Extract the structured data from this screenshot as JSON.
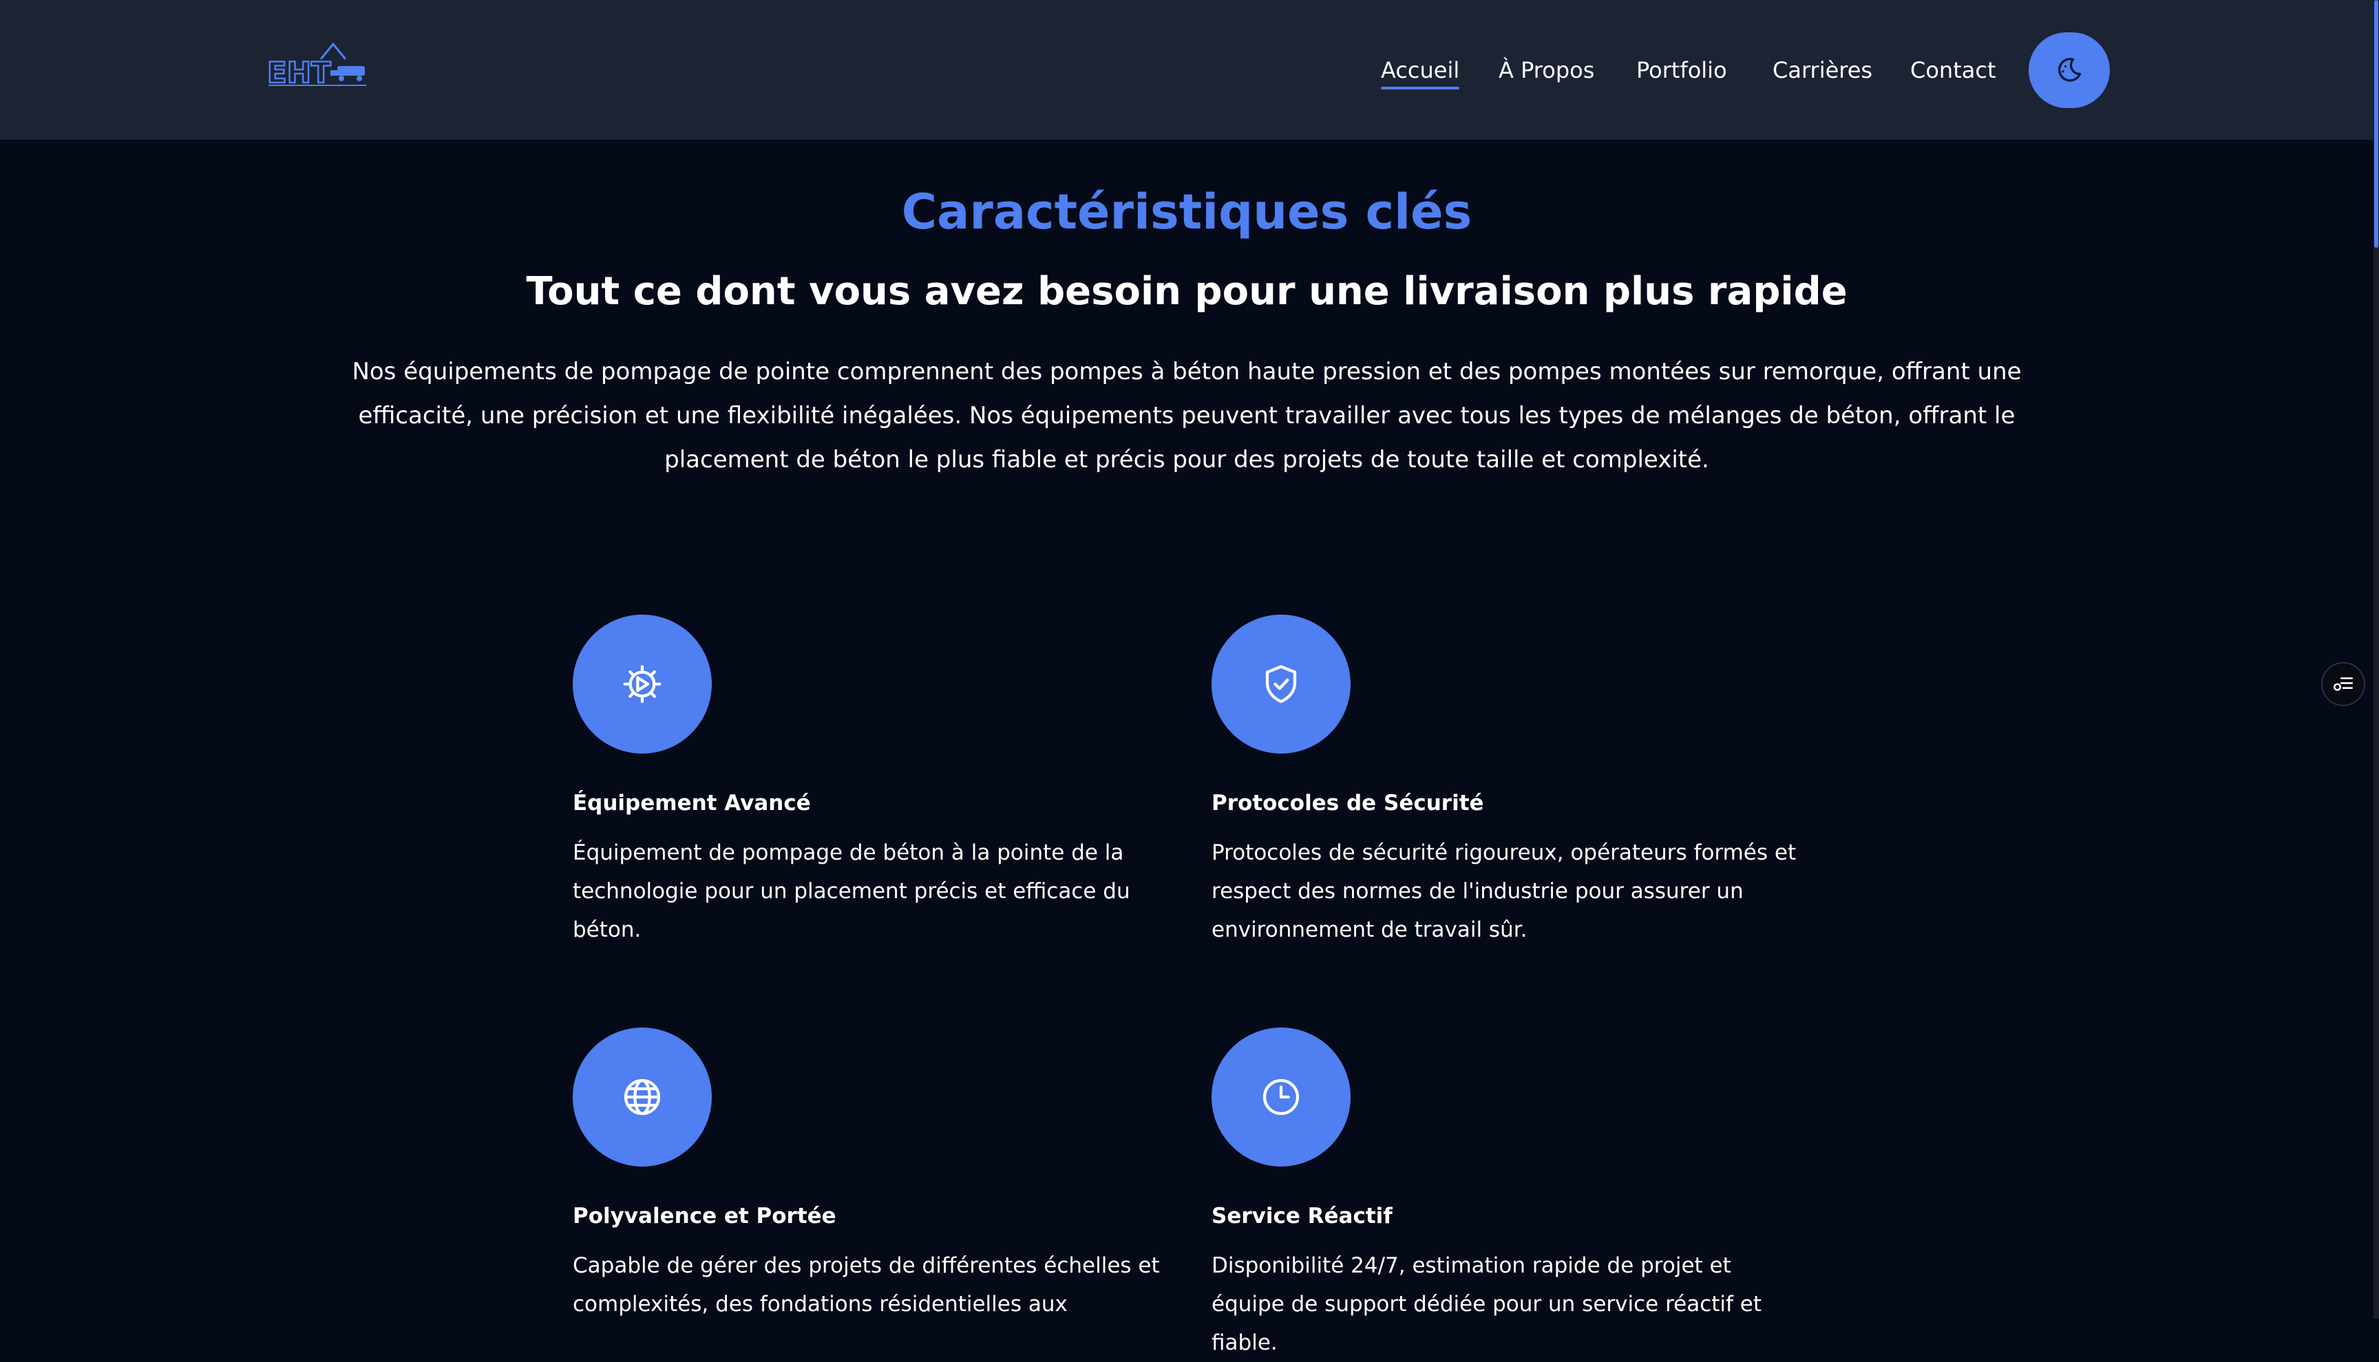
{
  "header": {
    "logo_alt": "EHT",
    "nav": [
      {
        "label": "Accueil",
        "active": true
      },
      {
        "label": "À Propos",
        "active": false
      },
      {
        "label": "Portfolio",
        "active": false
      },
      {
        "label": "Carrières",
        "active": false
      },
      {
        "label": "Contact",
        "active": false
      }
    ],
    "theme_toggle_icon": "moon-icon"
  },
  "section": {
    "eyebrow": "Caractéristiques clés",
    "headline": "Tout ce dont vous avez besoin pour une livraison plus rapide",
    "intro": "Nos équipements de pompage de pointe comprennent des pompes à béton haute pression et des pompes montées sur remorque, offrant une efficacité, une précision et une flexibilité inégalées. Nos équipements peuvent travailler avec tous les types de mélanges de béton, offrant le placement de béton le plus fiable et précis pour des projets de toute taille et complexité."
  },
  "features": [
    {
      "icon": "gear-icon",
      "title": "Équipement Avancé",
      "description": "Équipement de pompage de béton à la pointe de la technologie pour un placement précis et efficace du béton."
    },
    {
      "icon": "shield-check-icon",
      "title": "Protocoles de Sécurité",
      "description": "Protocoles de sécurité rigoureux, opérateurs formés et respect des normes de l'industrie pour assurer un environnement de travail sûr."
    },
    {
      "icon": "globe-icon",
      "title": "Polyvalence et Portée",
      "description": "Capable de gérer des projets de différentes échelles et complexités, des fondations résidentielles aux"
    },
    {
      "icon": "clock-icon",
      "title": "Service Réactif",
      "description": "Disponibilité 24/7, estimation rapide de projet et équipe de support dédiée pour un service réactif et fiable."
    }
  ],
  "colors": {
    "accent": "#4f7ff0",
    "header_bg": "#1c2333",
    "page_bg": "#050a18"
  }
}
